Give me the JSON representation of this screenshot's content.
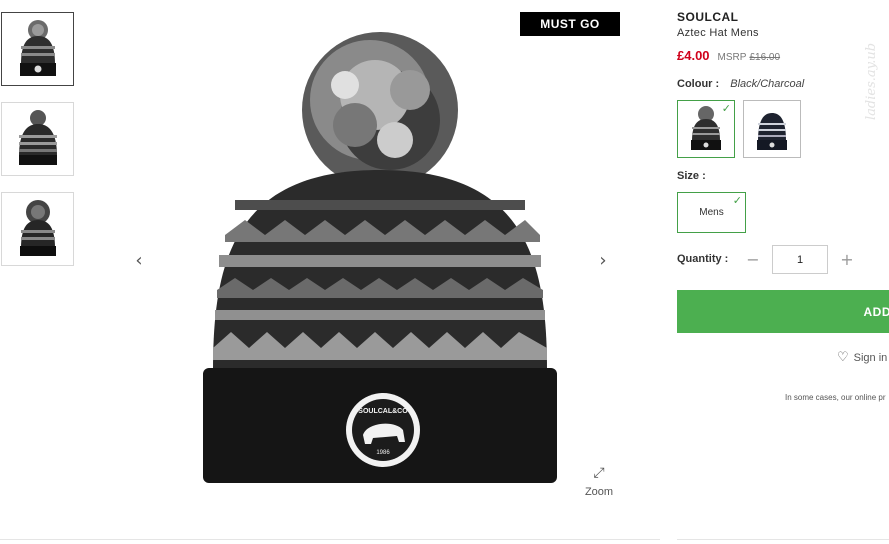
{
  "gallery": {
    "badge": "MUST GO",
    "zoom_label": "Zoom",
    "prev_icon": "chevron-left-icon",
    "next_icon": "chevron-right-icon",
    "selected_thumbnail": 1,
    "thumbnail_count": 3
  },
  "product": {
    "brand": "SOULCAL",
    "name": "Aztec Hat Mens",
    "price": "£4.00",
    "msrp_label": "MSRP",
    "original_price": "£16.00",
    "logo_text": "SOULCAL&CO",
    "logo_year": "1986"
  },
  "colour": {
    "label": "Colour :",
    "value": "Black/Charcoal",
    "options_count": 2,
    "selected_index": 1
  },
  "size": {
    "label": "Size :",
    "options": [
      "Mens"
    ],
    "selected": "Mens"
  },
  "quantity": {
    "label": "Quantity :",
    "value": "1"
  },
  "actions": {
    "add_label": "ADD",
    "signin_label": "Sign in"
  },
  "notice": "In some cases, our online pr",
  "watermark": "ladies.ay.ub",
  "colors": {
    "accent_green": "#4caf50",
    "sale_red": "#d0021b",
    "badge_black": "#000000"
  }
}
